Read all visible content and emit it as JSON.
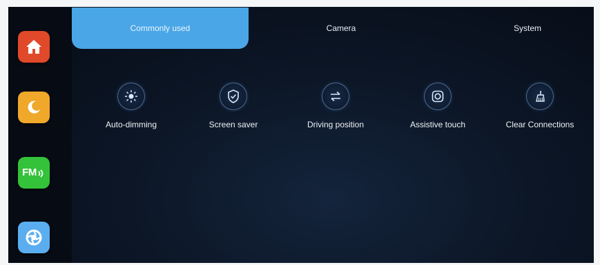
{
  "sidebar": {
    "apps": [
      {
        "name": "home",
        "icon": "home-icon",
        "color": "#e0492a"
      },
      {
        "name": "night-mode",
        "icon": "moon-icon",
        "color": "#f0a82a"
      },
      {
        "name": "fm-radio",
        "icon": "fm-radio-icon",
        "label": "FM",
        "color": "#33c23a"
      },
      {
        "name": "camera-shutter",
        "icon": "aperture-icon",
        "color": "#5aaef0"
      }
    ]
  },
  "tabs": [
    {
      "label": "Commonly used",
      "active": true
    },
    {
      "label": "Camera",
      "active": false
    },
    {
      "label": "System",
      "active": false
    }
  ],
  "features": [
    {
      "label": "Auto-dimming",
      "icon": "brightness-icon"
    },
    {
      "label": "Screen saver",
      "icon": "shield-icon"
    },
    {
      "label": "Driving position",
      "icon": "swap-arrows-icon"
    },
    {
      "label": "Assistive touch",
      "icon": "assistive-touch-icon"
    },
    {
      "label": "Clear Connections",
      "icon": "broom-icon"
    }
  ],
  "colors": {
    "accent": "#4aa6e6",
    "background": "#0c1626"
  }
}
